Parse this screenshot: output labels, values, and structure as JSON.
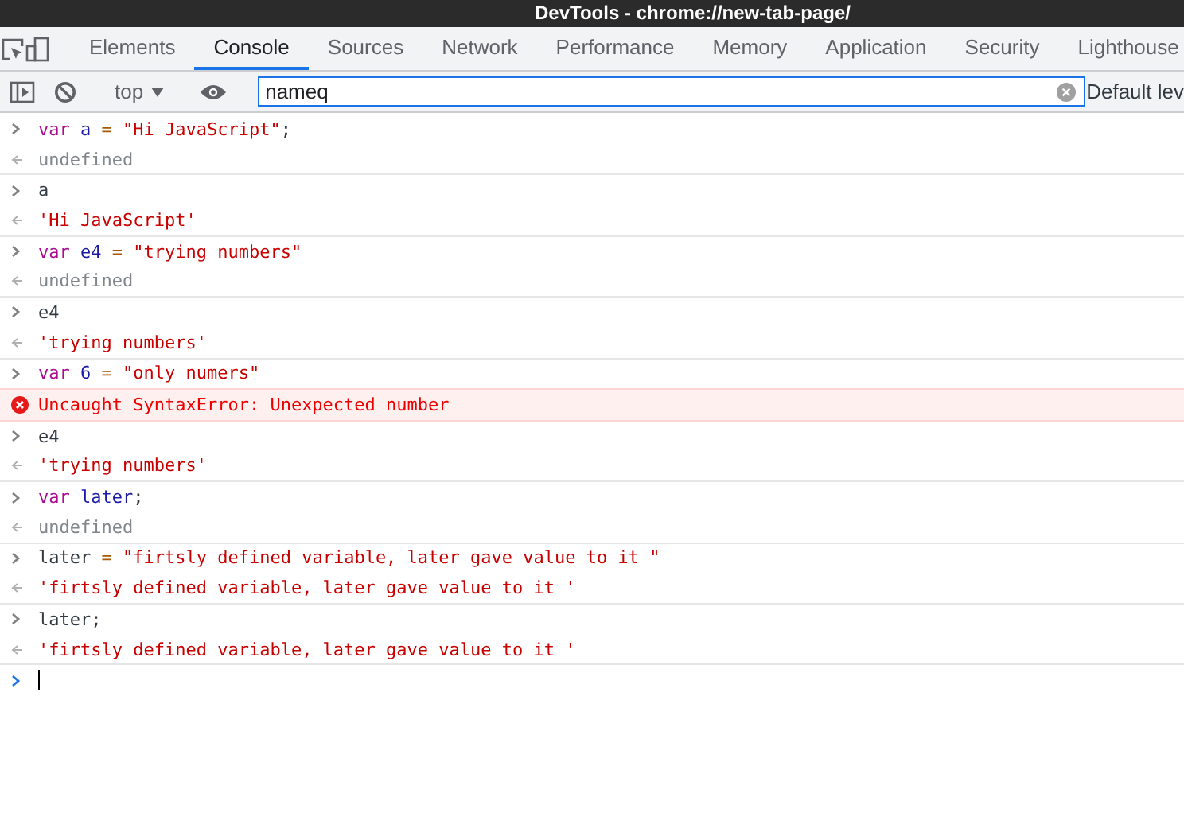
{
  "window": {
    "title": "DevTools - chrome://new-tab-page/"
  },
  "tabs": [
    {
      "label": "Elements",
      "selected": false
    },
    {
      "label": "Console",
      "selected": true
    },
    {
      "label": "Sources",
      "selected": false
    },
    {
      "label": "Network",
      "selected": false
    },
    {
      "label": "Performance",
      "selected": false
    },
    {
      "label": "Memory",
      "selected": false
    },
    {
      "label": "Application",
      "selected": false
    },
    {
      "label": "Security",
      "selected": false
    },
    {
      "label": "Lighthouse",
      "selected": false
    }
  ],
  "toolbar": {
    "context": "top",
    "filter": {
      "value": "nameq"
    },
    "levels": "Default lev"
  },
  "console": [
    {
      "input": [
        {
          "kind": "keyword",
          "text": "var"
        },
        {
          "kind": "variable",
          "text": " a"
        },
        {
          "kind": "operator",
          "text": " ="
        },
        {
          "kind": "string",
          "text": " \"Hi JavaScript\""
        },
        {
          "kind": "plain",
          "text": ";"
        }
      ],
      "output": {
        "kind": "undefined",
        "text": "undefined"
      }
    },
    {
      "input": [
        {
          "kind": "plain",
          "text": "a"
        }
      ],
      "output": {
        "kind": "string",
        "text": "'Hi JavaScript'"
      }
    },
    {
      "input": [
        {
          "kind": "keyword",
          "text": "var"
        },
        {
          "kind": "variable",
          "text": " e4"
        },
        {
          "kind": "operator",
          "text": " ="
        },
        {
          "kind": "string",
          "text": " \"trying numbers\""
        }
      ],
      "output": {
        "kind": "undefined",
        "text": "undefined"
      }
    },
    {
      "input": [
        {
          "kind": "plain",
          "text": "e4"
        }
      ],
      "output": {
        "kind": "string",
        "text": "'trying numbers'"
      }
    },
    {
      "input": [
        {
          "kind": "keyword",
          "text": "var"
        },
        {
          "kind": "variable",
          "text": " 6"
        },
        {
          "kind": "operator",
          "text": " ="
        },
        {
          "kind": "string",
          "text": " \"only numers\""
        }
      ],
      "output": {
        "kind": "error",
        "text": "Uncaught SyntaxError: Unexpected number"
      }
    },
    {
      "input": [
        {
          "kind": "plain",
          "text": "e4"
        }
      ],
      "output": {
        "kind": "string",
        "text": "'trying numbers'"
      }
    },
    {
      "input": [
        {
          "kind": "keyword",
          "text": "var"
        },
        {
          "kind": "variable",
          "text": " later"
        },
        {
          "kind": "plain",
          "text": ";"
        }
      ],
      "output": {
        "kind": "undefined",
        "text": "undefined"
      }
    },
    {
      "input": [
        {
          "kind": "plain",
          "text": "later"
        },
        {
          "kind": "operator",
          "text": " ="
        },
        {
          "kind": "string",
          "text": " \"firtsly defined variable, later gave value to it \""
        }
      ],
      "output": {
        "kind": "string",
        "text": "'firtsly defined variable, later gave value to it '"
      }
    },
    {
      "input": [
        {
          "kind": "plain",
          "text": "later;"
        }
      ],
      "output": {
        "kind": "string",
        "text": "'firtsly defined variable, later gave value to it '"
      }
    }
  ]
}
